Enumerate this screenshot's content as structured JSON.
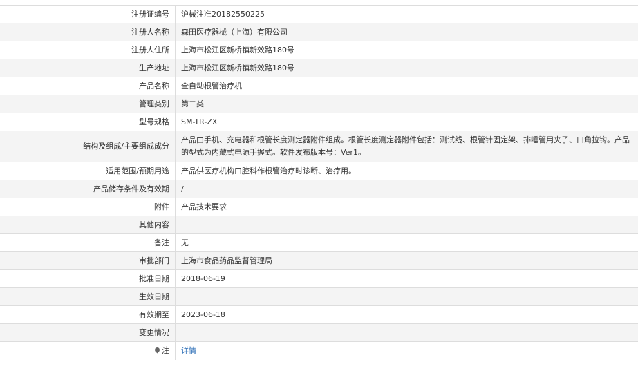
{
  "rows": [
    {
      "label": "注册证编号",
      "value": "沪械注准20182550225"
    },
    {
      "label": "注册人名称",
      "value": "森田医疗器械（上海）有限公司"
    },
    {
      "label": "注册人住所",
      "value": "上海市松江区新桥镇新效路180号"
    },
    {
      "label": "生产地址",
      "value": "上海市松江区新桥镇新效路180号"
    },
    {
      "label": "产品名称",
      "value": "全自动根管治疗机"
    },
    {
      "label": "管理类别",
      "value": "第二类"
    },
    {
      "label": "型号规格",
      "value": "SM-TR-ZX"
    },
    {
      "label": "结构及组成/主要组成成分",
      "value": "产品由手机、充电器和根管长度测定器附件组成。根管长度测定器附件包括：测试线、根管针固定架、排唾管用夹子、口角拉钩。产品的型式为内藏式电源手握式。软件发布版本号：Ver1。"
    },
    {
      "label": "适用范围/预期用途",
      "value": "产品供医疗机构口腔科作根管治疗时诊断、治疗用。"
    },
    {
      "label": "产品储存条件及有效期",
      "value": "/"
    },
    {
      "label": "附件",
      "value": "产品技术要求"
    },
    {
      "label": "其他内容",
      "value": ""
    },
    {
      "label": "备注",
      "value": "无"
    },
    {
      "label": "审批部门",
      "value": "上海市食品药品监督管理局"
    },
    {
      "label": "批准日期",
      "value": "2018-06-19"
    },
    {
      "label": "生效日期",
      "value": ""
    },
    {
      "label": "有效期至",
      "value": "2023-06-18"
    },
    {
      "label": "变更情况",
      "value": ""
    }
  ],
  "note": {
    "icon": "pin-icon",
    "label": "注",
    "link_text": "详情",
    "link_color": "#3071b8"
  }
}
